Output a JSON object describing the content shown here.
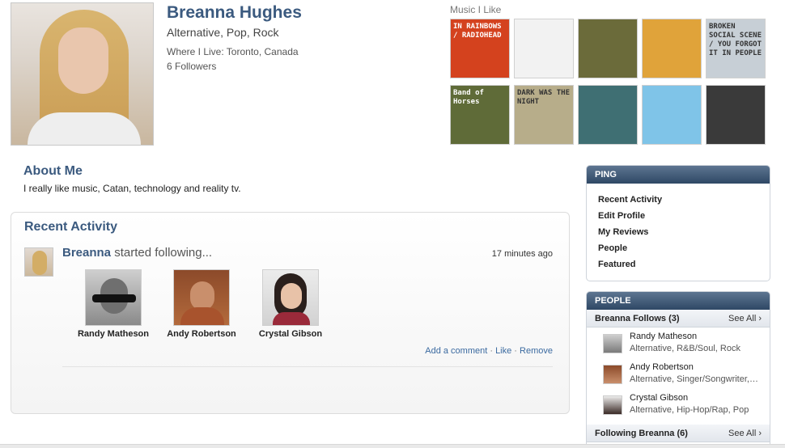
{
  "profile": {
    "name": "Breanna Hughes",
    "genres": "Alternative, Pop, Rock",
    "location": "Where I Live: Toronto, Canada",
    "followers": "6 Followers"
  },
  "music": {
    "title": "Music I Like",
    "albums": [
      {
        "label": "IN RAINBOWS / RADIOHEAD",
        "color": "#d4421e"
      },
      {
        "label": "",
        "color": "#f2f2f2"
      },
      {
        "label": "",
        "color": "#6b6b3a"
      },
      {
        "label": "",
        "color": "#e0a33a"
      },
      {
        "label": "BROKEN SOCIAL SCENE / YOU FORGOT IT IN PEOPLE",
        "color": "#c7cfd6"
      },
      {
        "label": "Band of Horses",
        "color": "#5f6b38"
      },
      {
        "label": "DARK WAS THE NIGHT",
        "color": "#b7ad8a"
      },
      {
        "label": "",
        "color": "#3f6f73"
      },
      {
        "label": "",
        "color": "#7fc4e8"
      },
      {
        "label": "",
        "color": "#3a3a3a"
      }
    ]
  },
  "about": {
    "title": "About Me",
    "text": "I really like music, Catan, technology and reality tv."
  },
  "activity": {
    "title": "Recent Activity",
    "user": "Breanna",
    "action": " started following...",
    "time": "17 minutes ago",
    "friends": [
      {
        "name": "Randy Matheson"
      },
      {
        "name": "Andy Robertson"
      },
      {
        "name": "Crystal Gibson"
      }
    ],
    "links": {
      "comment": "Add a comment",
      "like": "Like",
      "remove": "Remove",
      "separator": " · "
    }
  },
  "ping": {
    "title": "PING",
    "items": [
      "Recent Activity",
      "Edit Profile",
      "My Reviews",
      "People",
      "Featured"
    ]
  },
  "people": {
    "title": "PEOPLE",
    "follows_label": "Breanna Follows (3)",
    "see_all": "See All",
    "list": [
      {
        "name": "Randy Matheson",
        "genres": "Alternative, R&B/Soul, Rock"
      },
      {
        "name": "Andy Robertson",
        "genres": "Alternative, Singer/Songwriter, Indie"
      },
      {
        "name": "Crystal Gibson",
        "genres": "Alternative, Hip-Hop/Rap, Pop"
      }
    ],
    "following_label": "Following Breanna (6)",
    "see_all_2": "See All"
  }
}
